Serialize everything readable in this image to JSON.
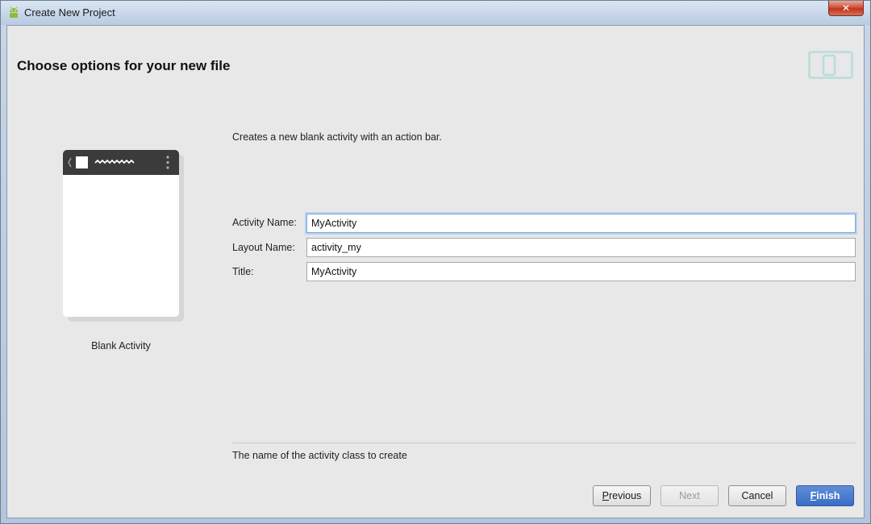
{
  "window": {
    "title": "Create New Project",
    "close_label": "✕"
  },
  "header": {
    "title": "Choose options for your new file"
  },
  "template": {
    "name": "Blank Activity",
    "description": "Creates a new blank activity with an action bar."
  },
  "form": {
    "fields": [
      {
        "label": "Activity Name:",
        "value": "MyActivity"
      },
      {
        "label": "Layout Name:",
        "value": "activity_my"
      },
      {
        "label": "Title:",
        "value": "MyActivity"
      }
    ],
    "hint": "The name of the activity class to create"
  },
  "buttons": {
    "previous_first": "P",
    "previous_rest": "revious",
    "next": "Next",
    "cancel": "Cancel",
    "finish_first": "F",
    "finish_rest": "inish"
  },
  "colors": {
    "accent": "#3a6cc4",
    "client_background": "#e8e8e8"
  },
  "icons": {
    "app": "android-icon",
    "header": "device-icon",
    "close": "close-icon"
  }
}
